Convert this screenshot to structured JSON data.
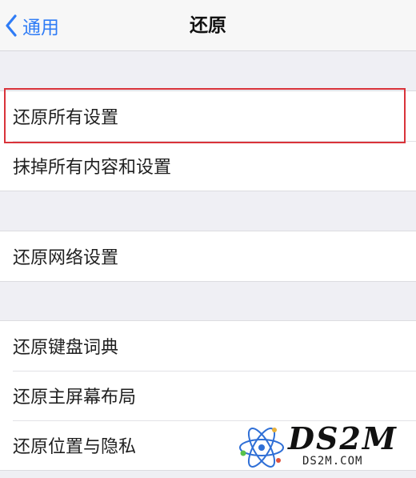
{
  "nav": {
    "back_label": "通用",
    "title": "还原"
  },
  "groups": [
    {
      "items": [
        "还原所有设置",
        "抹掉所有内容和设置"
      ]
    },
    {
      "items": [
        "还原网络设置"
      ]
    },
    {
      "items": [
        "还原键盘词典",
        "还原主屏幕布局",
        "还原位置与隐私"
      ]
    }
  ],
  "highlighted_item": "还原所有设置",
  "colors": {
    "accent": "#2f7cf6",
    "highlight_border": "#d9333a",
    "background": "#efeff4"
  },
  "watermark": {
    "name": "DS2M",
    "url": "DS2M.COM"
  }
}
